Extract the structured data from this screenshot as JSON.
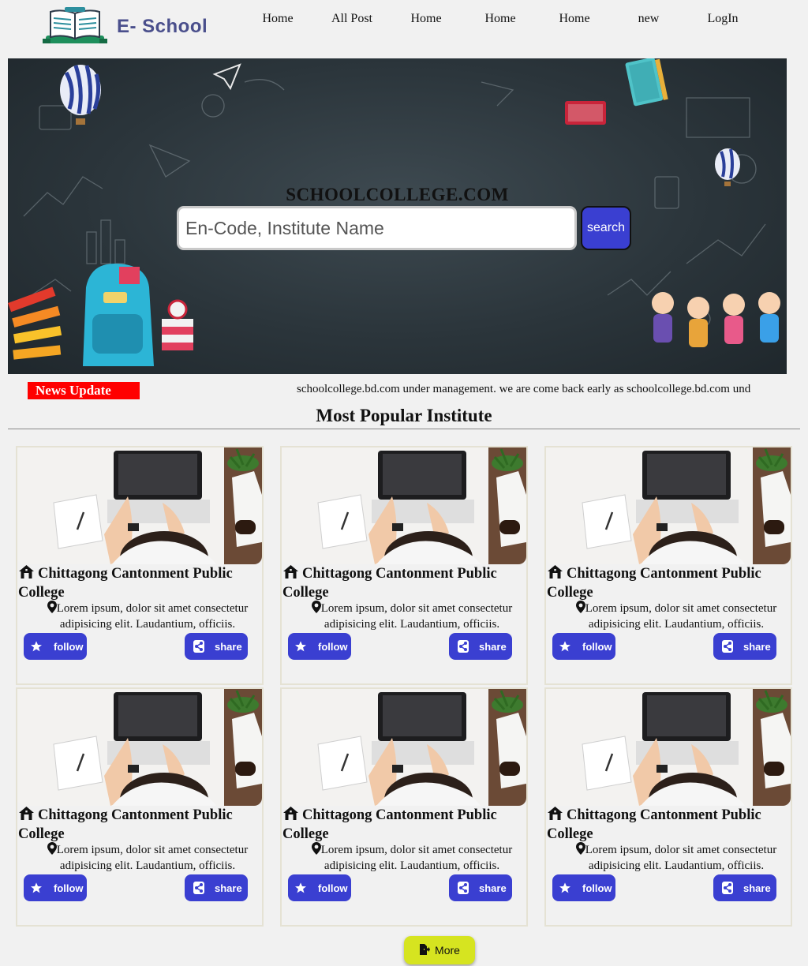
{
  "header": {
    "logo_text": "E- School",
    "nav": [
      "Home",
      "All Post",
      "Home",
      "Home",
      "Home",
      "new",
      "LogIn"
    ]
  },
  "hero": {
    "title": "SCHOOLCOLLEGE.COM",
    "search_placeholder": "En-Code, Institute Name",
    "search_button": "search"
  },
  "news": {
    "label": "News Update",
    "ticker": "schoolcollege.bd.com under management. we are come back early as schoolcollege.bd.com und"
  },
  "section": {
    "title": "Most Popular Institute"
  },
  "cards": [
    {
      "title": "Chittagong Cantonment Public College",
      "description": "Lorem ipsum, dolor sit amet consectetur adipisicing elit. Laudantium, officiis.",
      "follow_label": "follow",
      "share_label": "share"
    },
    {
      "title": "Chittagong Cantonment Public College",
      "description": "Lorem ipsum, dolor sit amet consectetur adipisicing elit. Laudantium, officiis.",
      "follow_label": "follow",
      "share_label": "share"
    },
    {
      "title": "Chittagong Cantonment Public College",
      "description": "Lorem ipsum, dolor sit amet consectetur adipisicing elit. Laudantium, officiis.",
      "follow_label": "follow",
      "share_label": "share"
    },
    {
      "title": "Chittagong Cantonment Public College",
      "description": "Lorem ipsum, dolor sit amet consectetur adipisicing elit. Laudantium, officiis.",
      "follow_label": "follow",
      "share_label": "share"
    },
    {
      "title": "Chittagong Cantonment Public College",
      "description": "Lorem ipsum, dolor sit amet consectetur adipisicing elit. Laudantium, officiis.",
      "follow_label": "follow",
      "share_label": "share"
    },
    {
      "title": "Chittagong Cantonment Public College",
      "description": "Lorem ipsum, dolor sit amet consectetur adipisicing elit. Laudantium, officiis.",
      "follow_label": "follow",
      "share_label": "share"
    }
  ],
  "more_button": "More",
  "colors": {
    "accent": "#3a3fd1",
    "news_label_bg": "#ff0000",
    "more_button_bg": "#d6e420",
    "logo_text": "#4a4f8c"
  },
  "icons": {
    "logo": "open-book-icon",
    "card_title": "home-icon",
    "card_location": "map-pin-icon",
    "follow": "star-icon",
    "share": "share-icon",
    "more": "export-icon"
  }
}
